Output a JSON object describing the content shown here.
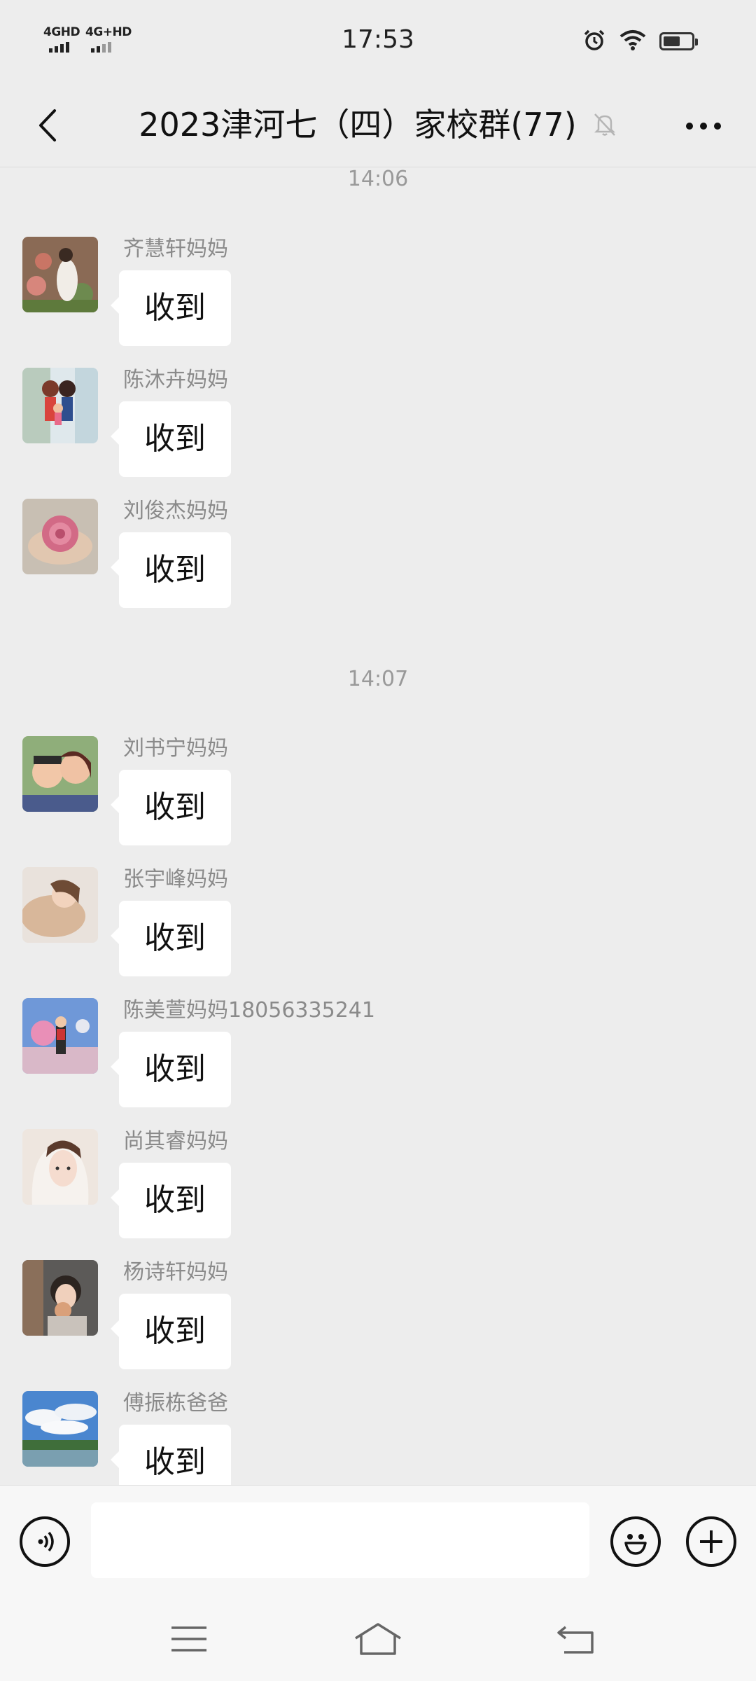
{
  "status_bar": {
    "time": "17:53",
    "network1": "4GHD",
    "network2": "4G+HD",
    "icons": [
      "alarm-icon",
      "wifi-icon",
      "battery-icon"
    ],
    "battery_level": 0.6
  },
  "header": {
    "title": "2023津河七（四）家校群(77)",
    "icons": [
      "back-icon",
      "mute-bell-icon",
      "more-icon"
    ]
  },
  "chat": {
    "separators": [
      "14:06",
      "14:07"
    ],
    "messages": [
      {
        "sender": "齐慧轩妈妈",
        "text": "收到"
      },
      {
        "sender": "陈沐卉妈妈",
        "text": "收到"
      },
      {
        "sender": "刘俊杰妈妈",
        "text": "收到"
      },
      {
        "sender": "刘书宁妈妈",
        "text": "收到"
      },
      {
        "sender": "张宇峰妈妈",
        "text": "收到"
      },
      {
        "sender": "陈美萱妈妈18056335241",
        "text": "收到"
      },
      {
        "sender": "尚其睿妈妈",
        "text": "收到"
      },
      {
        "sender": "杨诗轩妈妈",
        "text": "收到"
      },
      {
        "sender": "傅振栋爸爸",
        "text": "收到"
      }
    ]
  },
  "input_bar": {
    "value": "",
    "icons": [
      "voice-icon",
      "emoji-icon",
      "plus-icon"
    ]
  },
  "nav_bar": {
    "icons": [
      "menu-icon",
      "home-icon",
      "back-nav-icon"
    ]
  },
  "colors": {
    "background": "#ededed",
    "bubble": "#ffffff",
    "sender_text": "#8a8a8a",
    "input_bar": "#f7f7f7"
  }
}
